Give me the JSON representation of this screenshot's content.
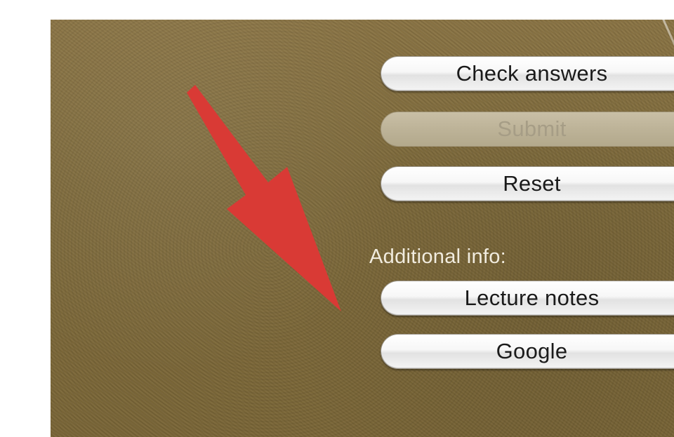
{
  "buttons": {
    "check_answers": "Check answers",
    "submit": "Submit",
    "reset": "Reset",
    "lecture_notes": "Lecture notes",
    "google": "Google"
  },
  "additional_info_label": "Additional info:",
  "states": {
    "submit_enabled": false
  },
  "colors": {
    "arrow": "#d93a35",
    "panel_background": "#7e6a3b"
  },
  "icons": {
    "annotation": "red-arrow-icon"
  }
}
